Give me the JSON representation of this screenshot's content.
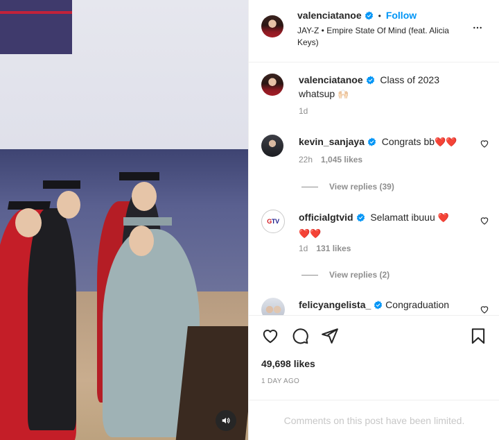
{
  "post": {
    "owner_username": "valenciatanoe",
    "follow_label": "Follow",
    "audio": "JAY-Z • Empire State Of Mind (feat. Alicia Keys)",
    "caption_username": "valenciatanoe",
    "caption_text": "Class of 2023 whatsup",
    "caption_emoji": "🙌🏻",
    "caption_time": "1d"
  },
  "comments": [
    {
      "username": "kevin_sanjaya",
      "text": "Congrats bb",
      "hearts": "❤️❤️",
      "time": "22h",
      "likes": "1,045 likes",
      "replies": "View replies (39)"
    },
    {
      "username": "officialgtvid",
      "text": "Selamatt ibuuu",
      "hearts": "❤️",
      "hearts_line2": "❤️❤️",
      "time": "1d",
      "likes": "131 likes",
      "replies": "View replies (2)"
    },
    {
      "username": "felicyangelista_",
      "text": "Congradua­tion"
    }
  ],
  "footer": {
    "likes": "49,698 likes",
    "date": "1 DAY AGO",
    "limited": "Comments on this post have been limited."
  },
  "icons": {
    "verified": "verified-badge-icon",
    "more": "more-options-icon",
    "like": "heart-icon",
    "comment": "comment-icon",
    "share": "share-icon",
    "save": "bookmark-icon",
    "sound": "speaker-icon"
  },
  "colors": {
    "accent": "#0095f6",
    "text": "#262626",
    "muted": "#8e8e8e",
    "heart_red": "#e0141e"
  }
}
